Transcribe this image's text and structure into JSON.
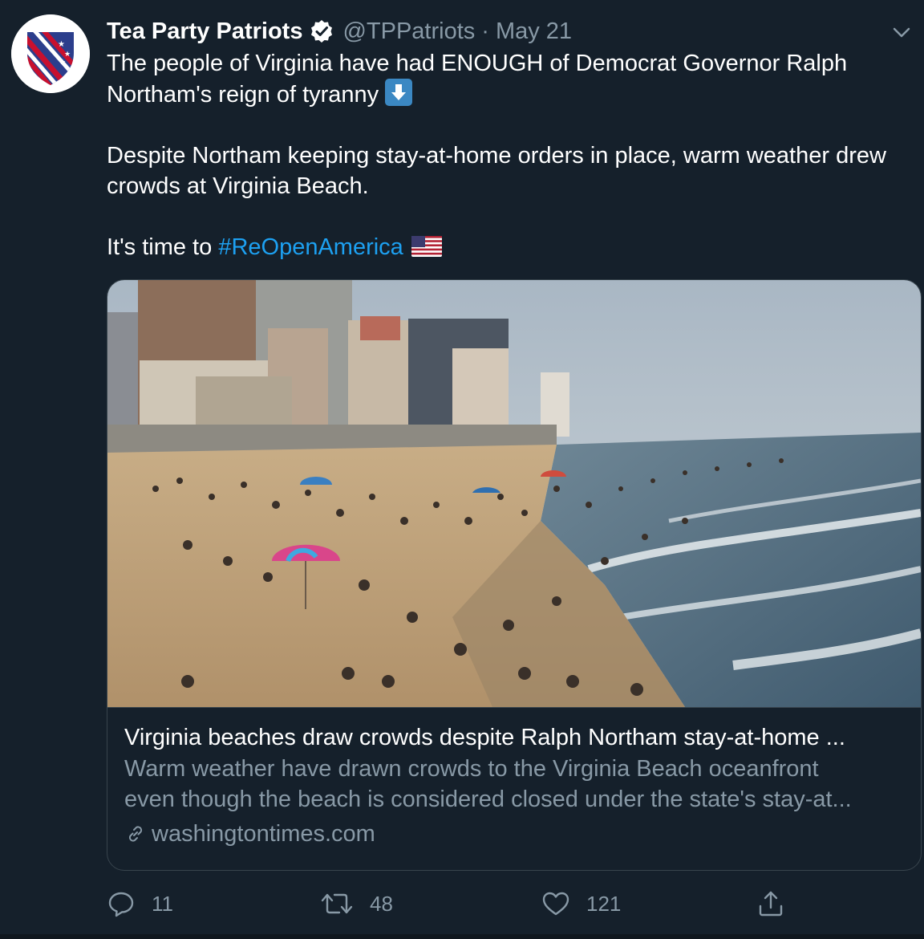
{
  "author": {
    "display_name": "Tea Party Patriots",
    "handle": "@TPPatriots",
    "separator": "·",
    "date": "May 21",
    "avatar_icon": "shield-flag-logo",
    "verified_icon": "verified-badge-icon"
  },
  "tweet": {
    "line1_text": "The people of Virginia have had ENOUGH of Democrat Governor Ralph Northam's reign of tyranny",
    "line1_emoji": "down-arrow-emoji",
    "para2": "Despite Northam keeping stay-at-home orders in place, warm weather drew crowds at Virginia Beach.",
    "para3_prefix": "It's time to",
    "hashtag": "#ReOpenAmerica",
    "para3_emoji": "us-flag-emoji"
  },
  "card": {
    "image_alt": "Crowded Virginia Beach oceanfront",
    "title": "Virginia beaches draw crowds despite Ralph Northam stay-at-home ...",
    "description_line1": "Warm weather have drawn crowds to the Virginia Beach oceanfront",
    "description_line2": "even though the beach is considered closed under the state's stay-at...",
    "domain": "washingtontimes.com"
  },
  "actions": {
    "reply_count": "11",
    "retweet_count": "48",
    "like_count": "121"
  },
  "colors": {
    "background": "#15202b",
    "accent": "#1da1f2",
    "muted": "#8899a6",
    "border": "#38444d"
  }
}
